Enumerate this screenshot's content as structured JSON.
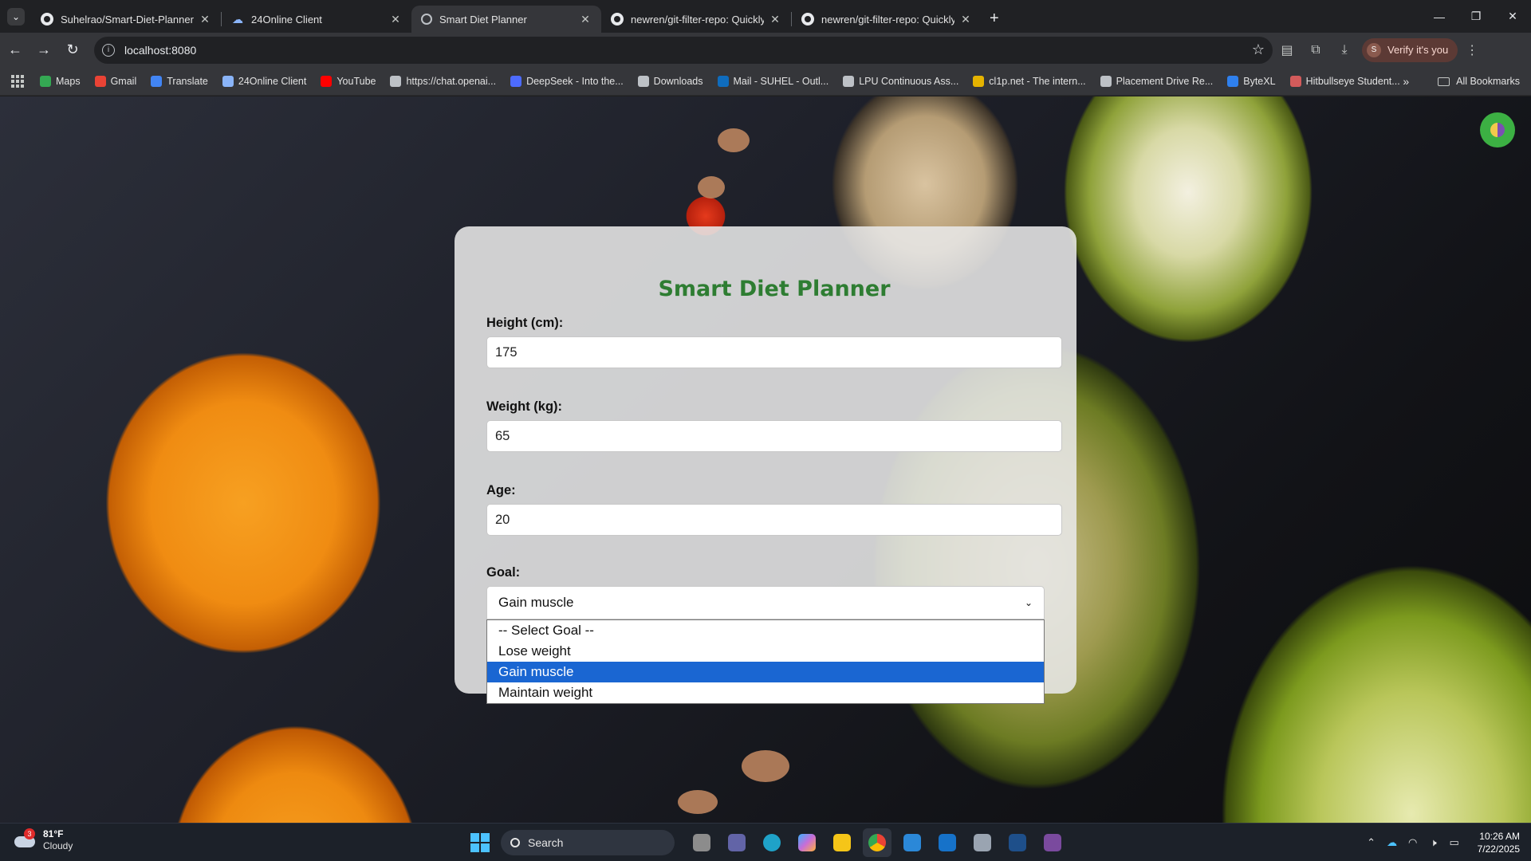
{
  "browser": {
    "tabs": [
      {
        "title": "Suhelrao/Smart-Diet-Planner",
        "icon": "github-icon",
        "active": false
      },
      {
        "title": "24Online Client",
        "icon": "cloud-icon",
        "active": false
      },
      {
        "title": "Smart Diet Planner",
        "icon": "globe-icon",
        "active": true
      },
      {
        "title": "newren/git-filter-repo: Quickly",
        "icon": "github-icon",
        "active": false
      },
      {
        "title": "newren/git-filter-repo: Quickly",
        "icon": "github-icon",
        "active": false
      }
    ],
    "url": "localhost:8080",
    "profile_label": "Verify it's you",
    "profile_initial": "S",
    "bookmarks": [
      {
        "label": "Maps",
        "color": "#34a853"
      },
      {
        "label": "Gmail",
        "color": "#ea4335"
      },
      {
        "label": "Translate",
        "color": "#4285f4"
      },
      {
        "label": "24Online Client",
        "color": "#8ab4f8"
      },
      {
        "label": "YouTube",
        "color": "#ff0000"
      },
      {
        "label": "https://chat.openai...",
        "color": "#bdc1c6"
      },
      {
        "label": "DeepSeek - Into the...",
        "color": "#4d6bfe"
      },
      {
        "label": "Downloads",
        "color": "#bdc1c6"
      },
      {
        "label": "Mail - SUHEL - Outl...",
        "color": "#0f6cbd"
      },
      {
        "label": "LPU Continuous Ass...",
        "color": "#bdc1c6"
      },
      {
        "label": "cl1p.net - The intern...",
        "color": "#e5b300"
      },
      {
        "label": "Placement Drive Re...",
        "color": "#bdc1c6"
      },
      {
        "label": "ByteXL",
        "color": "#2f80ed"
      },
      {
        "label": "Hitbullseye Student...",
        "color": "#d35b5b"
      }
    ],
    "all_bookmarks": "All Bookmarks"
  },
  "app": {
    "title": "Smart Diet Planner",
    "fields": {
      "height": {
        "label": "Height (cm):",
        "value": "175"
      },
      "weight": {
        "label": "Weight (kg):",
        "value": "65"
      },
      "age": {
        "label": "Age:",
        "value": "20"
      }
    },
    "goal": {
      "label": "Goal:",
      "selected": "Gain muscle",
      "options": [
        "-- Select Goal --",
        "Lose weight",
        "Gain muscle",
        "Maintain weight"
      ]
    }
  },
  "taskbar": {
    "weather_temp": "81°F",
    "weather_desc": "Cloudy",
    "weather_badge": "3",
    "search_label": "Search",
    "time": "10:26 AM",
    "date": "7/22/2025"
  },
  "colors": {
    "accent_green": "#2e7d32",
    "selection_blue": "#1a66d2"
  }
}
